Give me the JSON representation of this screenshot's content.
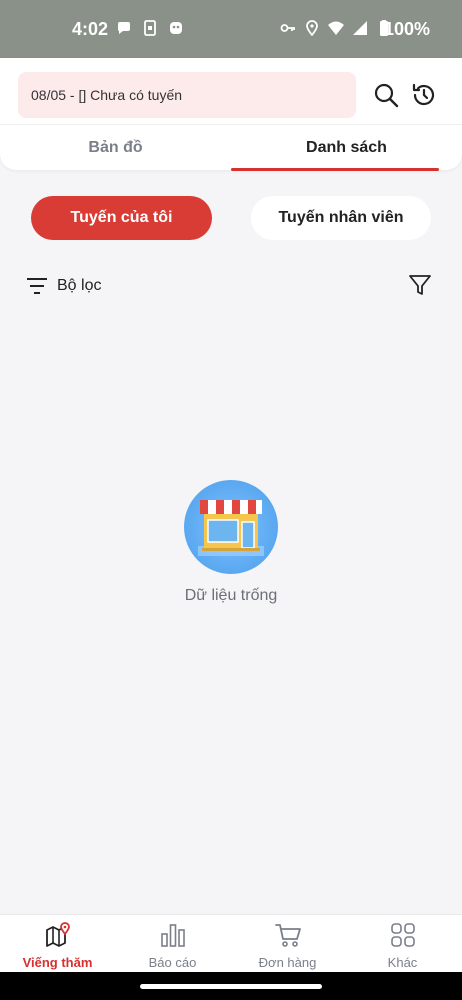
{
  "status_bar": {
    "time": "4:02",
    "battery": "100%"
  },
  "header": {
    "search_text": "08/05 - [] Chưa có tuyến",
    "tabs": [
      {
        "label": "Bản đồ"
      },
      {
        "label": "Danh sách"
      }
    ]
  },
  "segments": {
    "mine": "Tuyến của tôi",
    "staff": "Tuyến nhân viên"
  },
  "filter": {
    "label": "Bộ lọc"
  },
  "empty_state": {
    "text": "Dữ liệu trống"
  },
  "bottom_nav": {
    "items": [
      {
        "label": "Viếng thăm",
        "icon": "map-pin-icon"
      },
      {
        "label": "Báo cáo",
        "icon": "bar-chart-icon"
      },
      {
        "label": "Đơn hàng",
        "icon": "cart-icon"
      },
      {
        "label": "Khác",
        "icon": "grid-icon"
      }
    ]
  },
  "colors": {
    "accent": "#d6312f",
    "accent_button": "#d93b35",
    "search_bg": "#fdebec",
    "status_bar_bg": "#8a9189"
  }
}
